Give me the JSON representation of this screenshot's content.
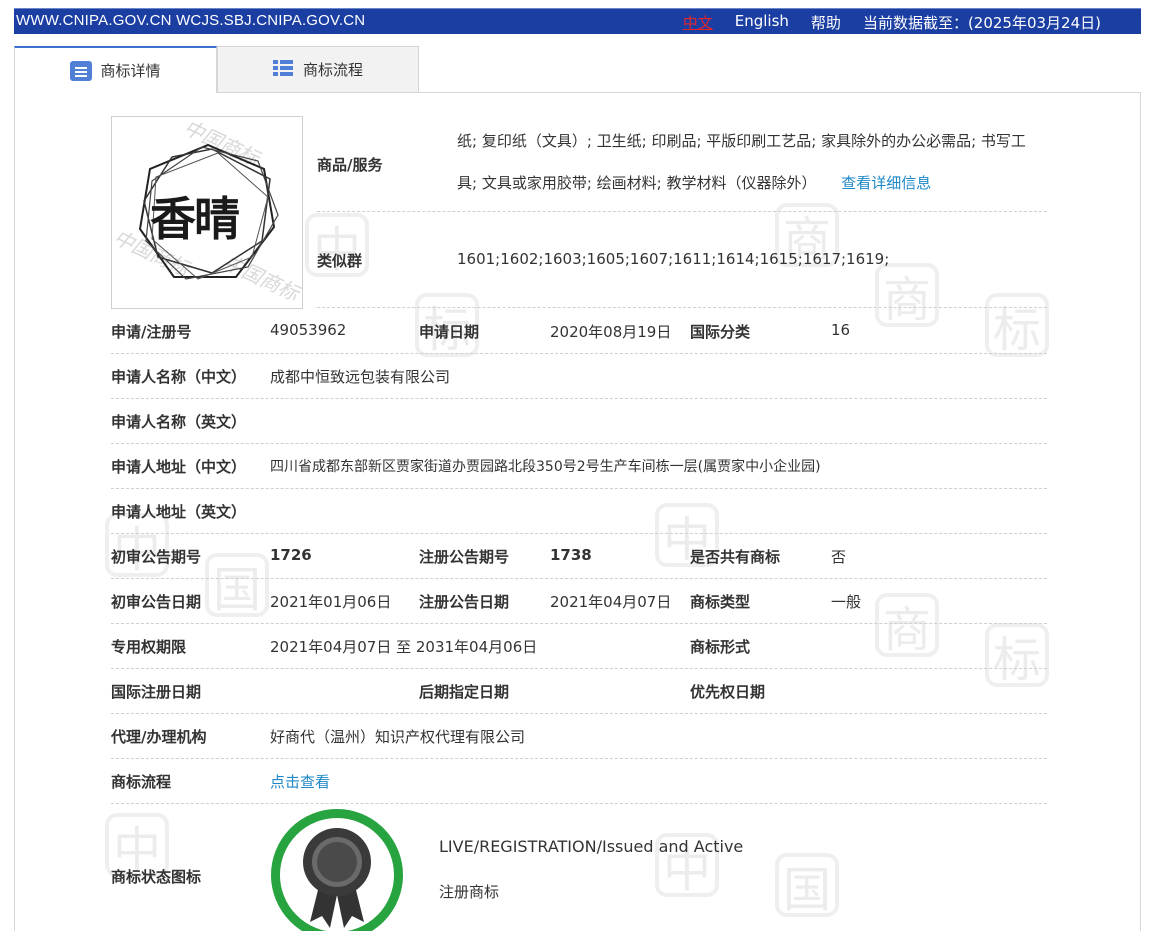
{
  "topbar": {
    "site": "WWW.CNIPA.GOV.CN WCJS.SBJ.CNIPA.GOV.CN",
    "lang_cn": "中文",
    "lang_en": "English",
    "help": "帮助",
    "data_date": "当前数据截至：(2025年03月24日)"
  },
  "tabs": [
    {
      "label": "商标详情",
      "icon": "document-icon",
      "active": true
    },
    {
      "label": "商标流程",
      "icon": "list-icon",
      "active": false
    }
  ],
  "goods": {
    "label": "商品/服务",
    "line1": "纸; 复印纸（文具）; 卫生纸; 印刷品; 平版印刷工艺品; 家具除外的办公必需品; 书写工",
    "line2": "具; 文具或家用胶带; 绘画材料; 教学材料（仪器除外）",
    "detail_link": "查看详细信息"
  },
  "similar": {
    "label": "类似群",
    "value": "1601;1602;1603;1605;1607;1611;1614;1615;1617;1619;"
  },
  "logo": {
    "mark_text": "香晴",
    "watermark": "中国商标"
  },
  "fields": {
    "reg_no_label": "申请/注册号",
    "reg_no": "49053962",
    "app_date_label": "申请日期",
    "app_date": "2020年08月19日",
    "intl_class_label": "国际分类",
    "intl_class": "16",
    "applicant_cn_label": "申请人名称（中文）",
    "applicant_cn": "成都中恒致远包装有限公司",
    "applicant_en_label": "申请人名称（英文）",
    "address_cn_label": "申请人地址（中文）",
    "address_cn": "四川省成都东部新区贾家街道办贾园路北段350号2号生产车间栋一层(属贾家中小企业园)",
    "address_en_label": "申请人地址（英文）",
    "prelim_no_label": "初审公告期号",
    "prelim_no": "1726",
    "reg_pub_no_label": "注册公告期号",
    "reg_pub_no": "1738",
    "shared_label": "是否共有商标",
    "shared": "否",
    "prelim_date_label": "初审公告日期",
    "prelim_date": "2021年01月06日",
    "reg_pub_date_label": "注册公告日期",
    "reg_pub_date": "2021年04月07日",
    "mark_type_label": "商标类型",
    "mark_type": "一般",
    "period_label": "专用权期限",
    "period": "2021年04月07日 至 2031年04月06日",
    "mark_form_label": "商标形式",
    "intl_reg_date_label": "国际注册日期",
    "later_date_label": "后期指定日期",
    "priority_date_label": "优先权日期",
    "agent_label": "代理/办理机构",
    "agent": "好商代（温州）知识产权代理有限公司",
    "flow_label": "商标流程",
    "flow_link": "点击查看",
    "status_icon_label": "商标状态图标",
    "status_en": "LIVE/REGISTRATION/Issued and Active",
    "status_cn": "注册商标"
  },
  "colors": {
    "topbar": "#1b3ea3",
    "link": "#1e88c8",
    "badge_ring": "#27a33f",
    "tab_icon": "#4f80d6"
  }
}
